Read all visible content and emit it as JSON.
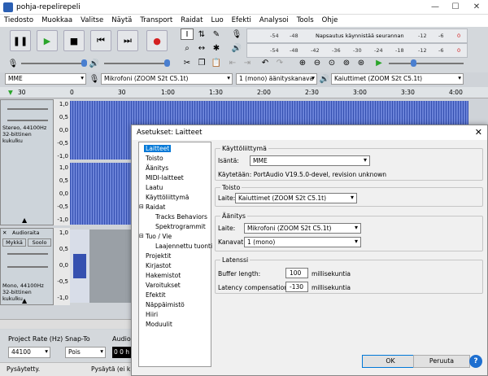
{
  "window": {
    "title": "pohja-repelirepeli",
    "minimize": "—",
    "maximize": "☐",
    "close": "✕"
  },
  "menu": [
    "Tiedosto",
    "Muokkaa",
    "Valitse",
    "Näytä",
    "Transport",
    "Raidat",
    "Luo",
    "Efekti",
    "Analysoi",
    "Tools",
    "Ohje"
  ],
  "transport": {
    "pause": "❚❚",
    "play": "▶",
    "stop": "■",
    "skip_start": "⏮",
    "skip_end": "⏭",
    "record": "●"
  },
  "meter": {
    "record_scale": [
      "-54",
      "-48",
      "Napsautus käynnistää seurannan",
      "-12",
      "-6",
      "0"
    ],
    "play_scale": [
      "-54",
      "-48",
      "-42",
      "-36",
      "-30",
      "-24",
      "-18",
      "-12",
      "-6",
      "0"
    ]
  },
  "devices": {
    "host": "MME",
    "recording": "Mikrofoni (ZOOM S2t C5.1t)",
    "channels": "1 (mono) äänityskanava",
    "playback": "Kaiuttimet (ZOOM S2t C5.1t)"
  },
  "ruler": [
    "30",
    "0",
    "30",
    "1:00",
    "1:30",
    "2:00",
    "2:30",
    "3:00",
    "3:30",
    "4:00"
  ],
  "track1": {
    "info": "Stereo, 44100Hz",
    "info2": "32-bittinen kukulku",
    "scale": [
      "1,0",
      "0,5",
      "0,0",
      "-0,5",
      "-1,0",
      "1,0",
      "0,5",
      "0,0",
      "-0,5",
      "-1,0"
    ]
  },
  "track2": {
    "name": "Audioraita",
    "mute": "Mykkä",
    "solo": "Soolo",
    "info": "Mono, 44100Hz",
    "info2": "32-bittinen kukulku",
    "scale": [
      "1,0",
      "0,5",
      "0,0",
      "-0,5",
      "-1,0"
    ]
  },
  "bottom": {
    "rate_label": "Project Rate (Hz)",
    "snap_label": "Snap-To",
    "audio_label": "Audio",
    "rate": "44100",
    "snap": "Pois",
    "time": "0 0 h"
  },
  "status": {
    "left": "Pysäytetty.",
    "mid": "Pysäytä (ei k"
  },
  "dialog": {
    "title": "Asetukset: Laitteet",
    "tree": [
      "Laitteet",
      "Toisto",
      "Äänitys",
      "MIDI-laitteet",
      "Laatu",
      "Käyttöliittymä",
      "Raidat",
      "Tracks Behaviors",
      "Spektrogrammit",
      "Tuo / Vie",
      "Laajennettu tuonti",
      "Projektit",
      "Kirjastot",
      "Hakemistot",
      "Varoitukset",
      "Efektit",
      "Näppäimistö",
      "Hiiri",
      "Moduulit"
    ],
    "interface": {
      "heading": "Käyttöliittymä",
      "host_label": "Isäntä:",
      "host": "MME",
      "using": "Käytetään: PortAudio V19.5.0-devel, revision unknown"
    },
    "playback": {
      "heading": "Toisto",
      "device_label": "Laite:",
      "device": "Kaiuttimet (ZOOM S2t C5.1t)"
    },
    "recording": {
      "heading": "Äänitys",
      "device_label": "Laite:",
      "device": "Mikrofoni (ZOOM S2t C5.1t)",
      "channels_label": "Kanavat:",
      "channels": "1 (mono)"
    },
    "latency": {
      "heading": "Latenssi",
      "buffer_label": "Buffer length:",
      "buffer": "100",
      "buffer_unit": "millisekuntia",
      "comp_label": "Latency compensation:",
      "comp": "-130",
      "comp_unit": "millisekuntia"
    },
    "ok": "OK",
    "cancel": "Peruuta",
    "help": "?"
  },
  "colors": {
    "wave": "#4059b5",
    "accent": "#0078d7",
    "record": "#d42020",
    "play": "#2aa52a"
  }
}
